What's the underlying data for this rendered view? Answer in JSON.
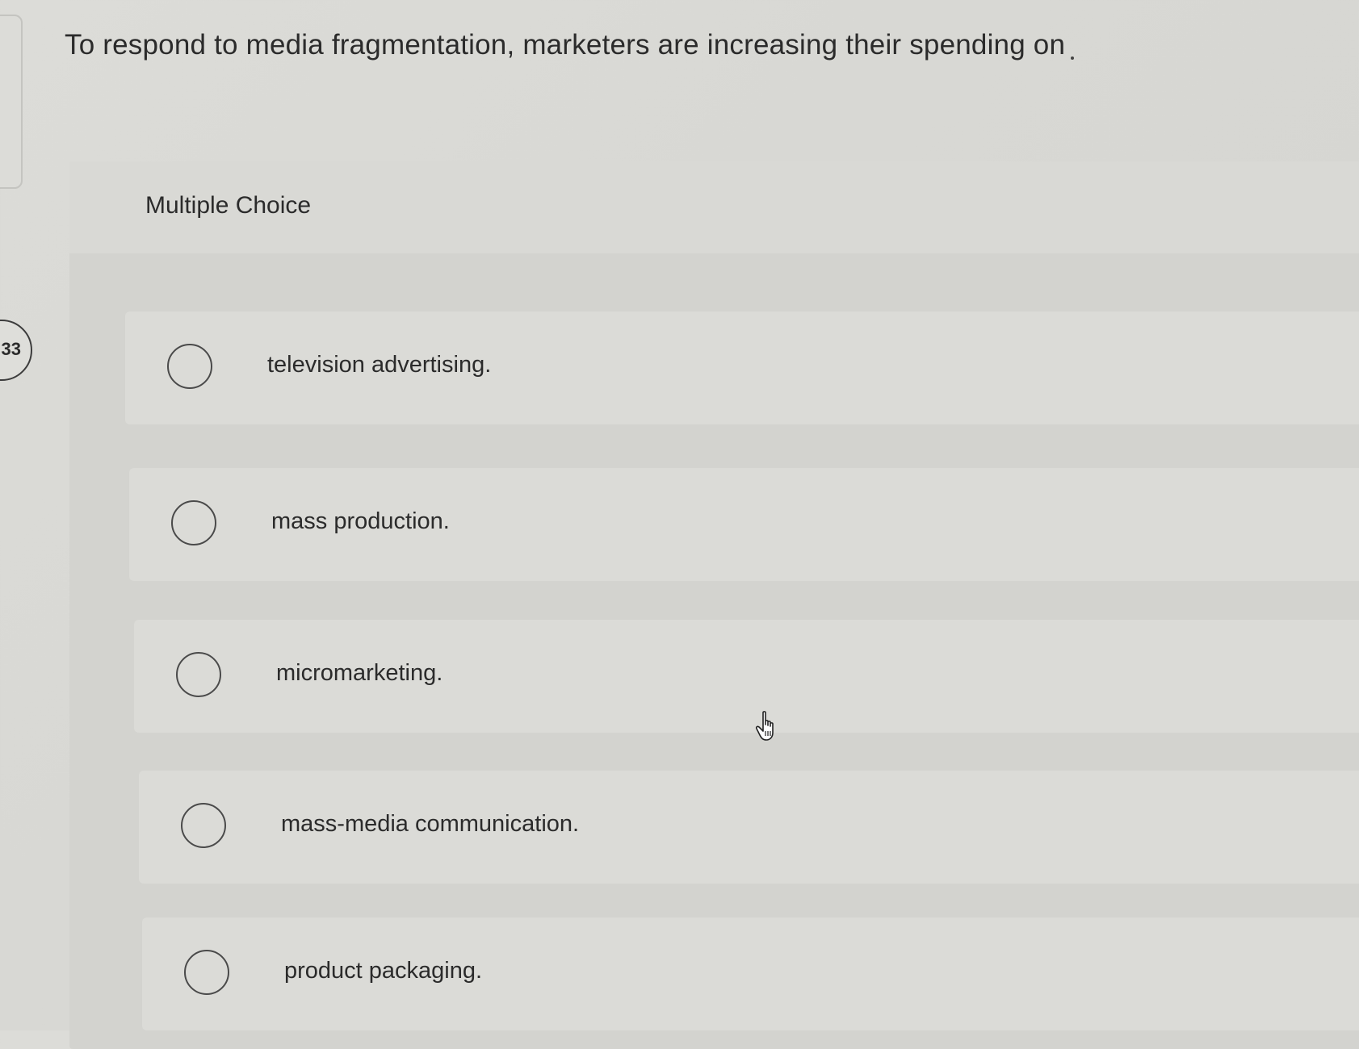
{
  "question": {
    "number": "33",
    "text": "To respond to media fragmentation, marketers are increasing their spending on"
  },
  "multiple_choice": {
    "label": "Multiple Choice",
    "options": [
      {
        "label": "television advertising.",
        "selected": false
      },
      {
        "label": "mass production.",
        "selected": false
      },
      {
        "label": "micromarketing.",
        "selected": false
      },
      {
        "label": "mass-media communication.",
        "selected": false
      },
      {
        "label": "product packaging.",
        "selected": false
      }
    ]
  },
  "cursor": {
    "icon": "hand-pointer-icon"
  }
}
